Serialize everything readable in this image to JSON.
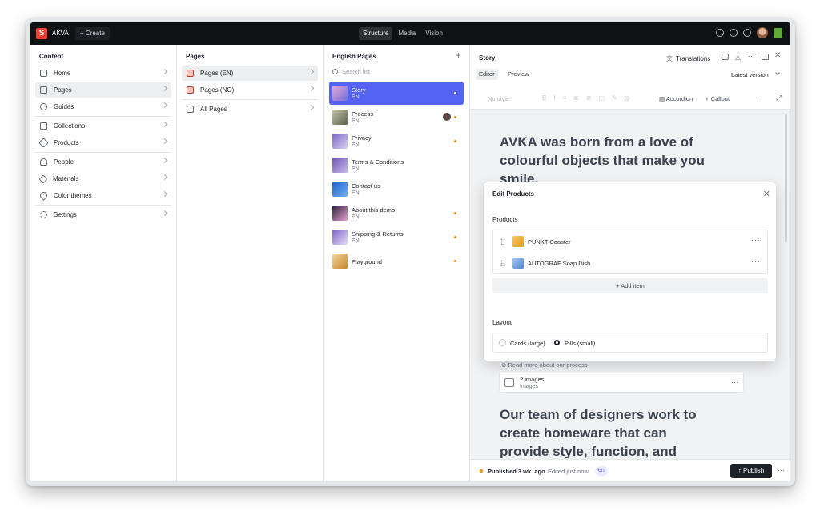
{
  "topbar": {
    "brand": "AKVA",
    "create_label": "+ Create",
    "tools": [
      "Structure",
      "Media",
      "Vision"
    ]
  },
  "content_pane": {
    "title": "Content",
    "items": [
      {
        "label": "Home",
        "icon": "home-icon"
      },
      {
        "label": "Pages",
        "icon": "page-icon"
      },
      {
        "label": "Guides",
        "icon": "globe-icon"
      },
      {
        "label": "Collections",
        "icon": "cube-icon"
      },
      {
        "label": "Products",
        "icon": "tag-icon"
      },
      {
        "label": "People",
        "icon": "user-icon"
      },
      {
        "label": "Materials",
        "icon": "diamond-icon"
      },
      {
        "label": "Color themes",
        "icon": "pin-icon"
      },
      {
        "label": "Settings",
        "icon": "gear-icon"
      }
    ]
  },
  "pages_pane": {
    "title": "Pages",
    "items": [
      {
        "label": "Pages (EN)"
      },
      {
        "label": "Pages (NO)"
      },
      {
        "label": "All Pages"
      }
    ]
  },
  "english_pane": {
    "title": "English Pages",
    "search_placeholder": "Search list",
    "items": [
      {
        "title": "Story",
        "sub": "EN"
      },
      {
        "title": "Process",
        "sub": "EN"
      },
      {
        "title": "Privacy",
        "sub": "EN"
      },
      {
        "title": "Terms & Conditions",
        "sub": "EN"
      },
      {
        "title": "Contact us",
        "sub": "EN"
      },
      {
        "title": "About this demo",
        "sub": "EN"
      },
      {
        "title": "Shipping & Returns",
        "sub": "EN"
      },
      {
        "title": "Playground",
        "sub": ""
      }
    ]
  },
  "editor": {
    "title": "Story",
    "translations_label": "Translations",
    "tabs": [
      "Editor",
      "Preview"
    ],
    "version_label": "Latest version",
    "style_placeholder": "No style",
    "accordion_label": "Accordion",
    "callout_label": "Callout",
    "heading1": [
      "AVKA was born from a love of",
      "colourful objects that make you",
      "smile."
    ],
    "link_text": "Read more about our process",
    "images_title": "2 images",
    "images_sub": "Images",
    "heading2": [
      "Our team of designers work to",
      "create homeware that can",
      "provide style, function, and"
    ],
    "status": "Published 3 wk. ago",
    "edited": "Edited just now",
    "lang_badge": "en",
    "publish_label": "Publish"
  },
  "modal": {
    "title": "Edit Products",
    "products_label": "Products",
    "products": [
      {
        "label": "PUNKT Coaster"
      },
      {
        "label": "AUTOGRAF Soap Dish"
      }
    ],
    "add_item_label": "Add item",
    "layout_label": "Layout",
    "layout_options": [
      "Cards (large)",
      "Pills (small)"
    ],
    "layout_selected": "Pills (small)"
  },
  "colors": {
    "topbar": "#101112",
    "selected_doc": "#5563f4",
    "logo": "#f03e2f",
    "unpublished_dot": "#f0930a"
  }
}
